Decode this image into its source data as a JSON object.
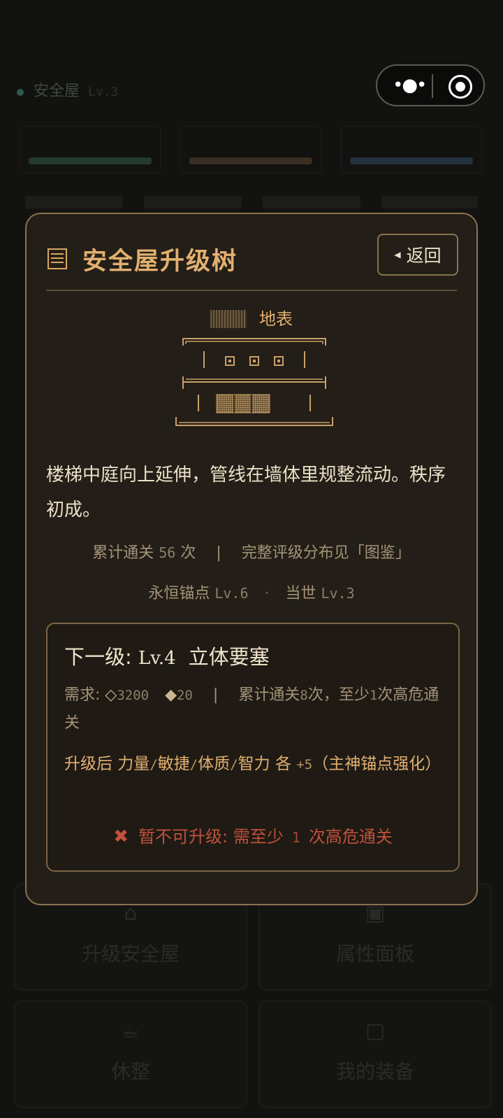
{
  "capsule": {
    "more_icon": "more-dots-icon",
    "close_icon": "target-icon"
  },
  "background": {
    "title": "安全屋",
    "version": "Lv.3",
    "cards": [
      "升级安全屋",
      "属性面板",
      "休整",
      "我的装备"
    ]
  },
  "modal": {
    "title": "安全屋升级树",
    "back_label": "返回",
    "floor": {
      "label": "地表"
    },
    "description": "楼梯中庭向上延伸，管线在墙体里规整流动。秩序初成。",
    "stats": {
      "clears_label": "累计通关",
      "clears_count": "56",
      "clears_unit": "次",
      "gallery_note": "完整评级分布见「图鉴」",
      "anchor_label": "永恒锚点",
      "anchor_level": "Lv.6",
      "current_label": "当世",
      "current_level": "Lv.3"
    },
    "next": {
      "prefix": "下一级:",
      "level": "Lv.4",
      "name": "立体要塞",
      "req_label": "需求:",
      "cost_a": "3200",
      "cost_b": "20",
      "req_clears_a": "累计通关",
      "req_clears_num": "8",
      "req_clears_b": "次，至少",
      "req_danger_num": "1",
      "req_clears_c": "次高危通关",
      "bonus_prefix": "升级后  力量",
      "bonus_stats": [
        "敏捷",
        "体质",
        "智力"
      ],
      "bonus_each": "各",
      "bonus_value": "+5",
      "bonus_suffix": "（主神锚点强化）",
      "warn_prefix": "暂不可升级: 需至少",
      "warn_num": "1",
      "warn_suffix": "次高危通关"
    }
  },
  "colors": {
    "accent": "#e2b070",
    "border": "#8a7350",
    "danger": "#c0513b",
    "panel": "#231e17"
  }
}
